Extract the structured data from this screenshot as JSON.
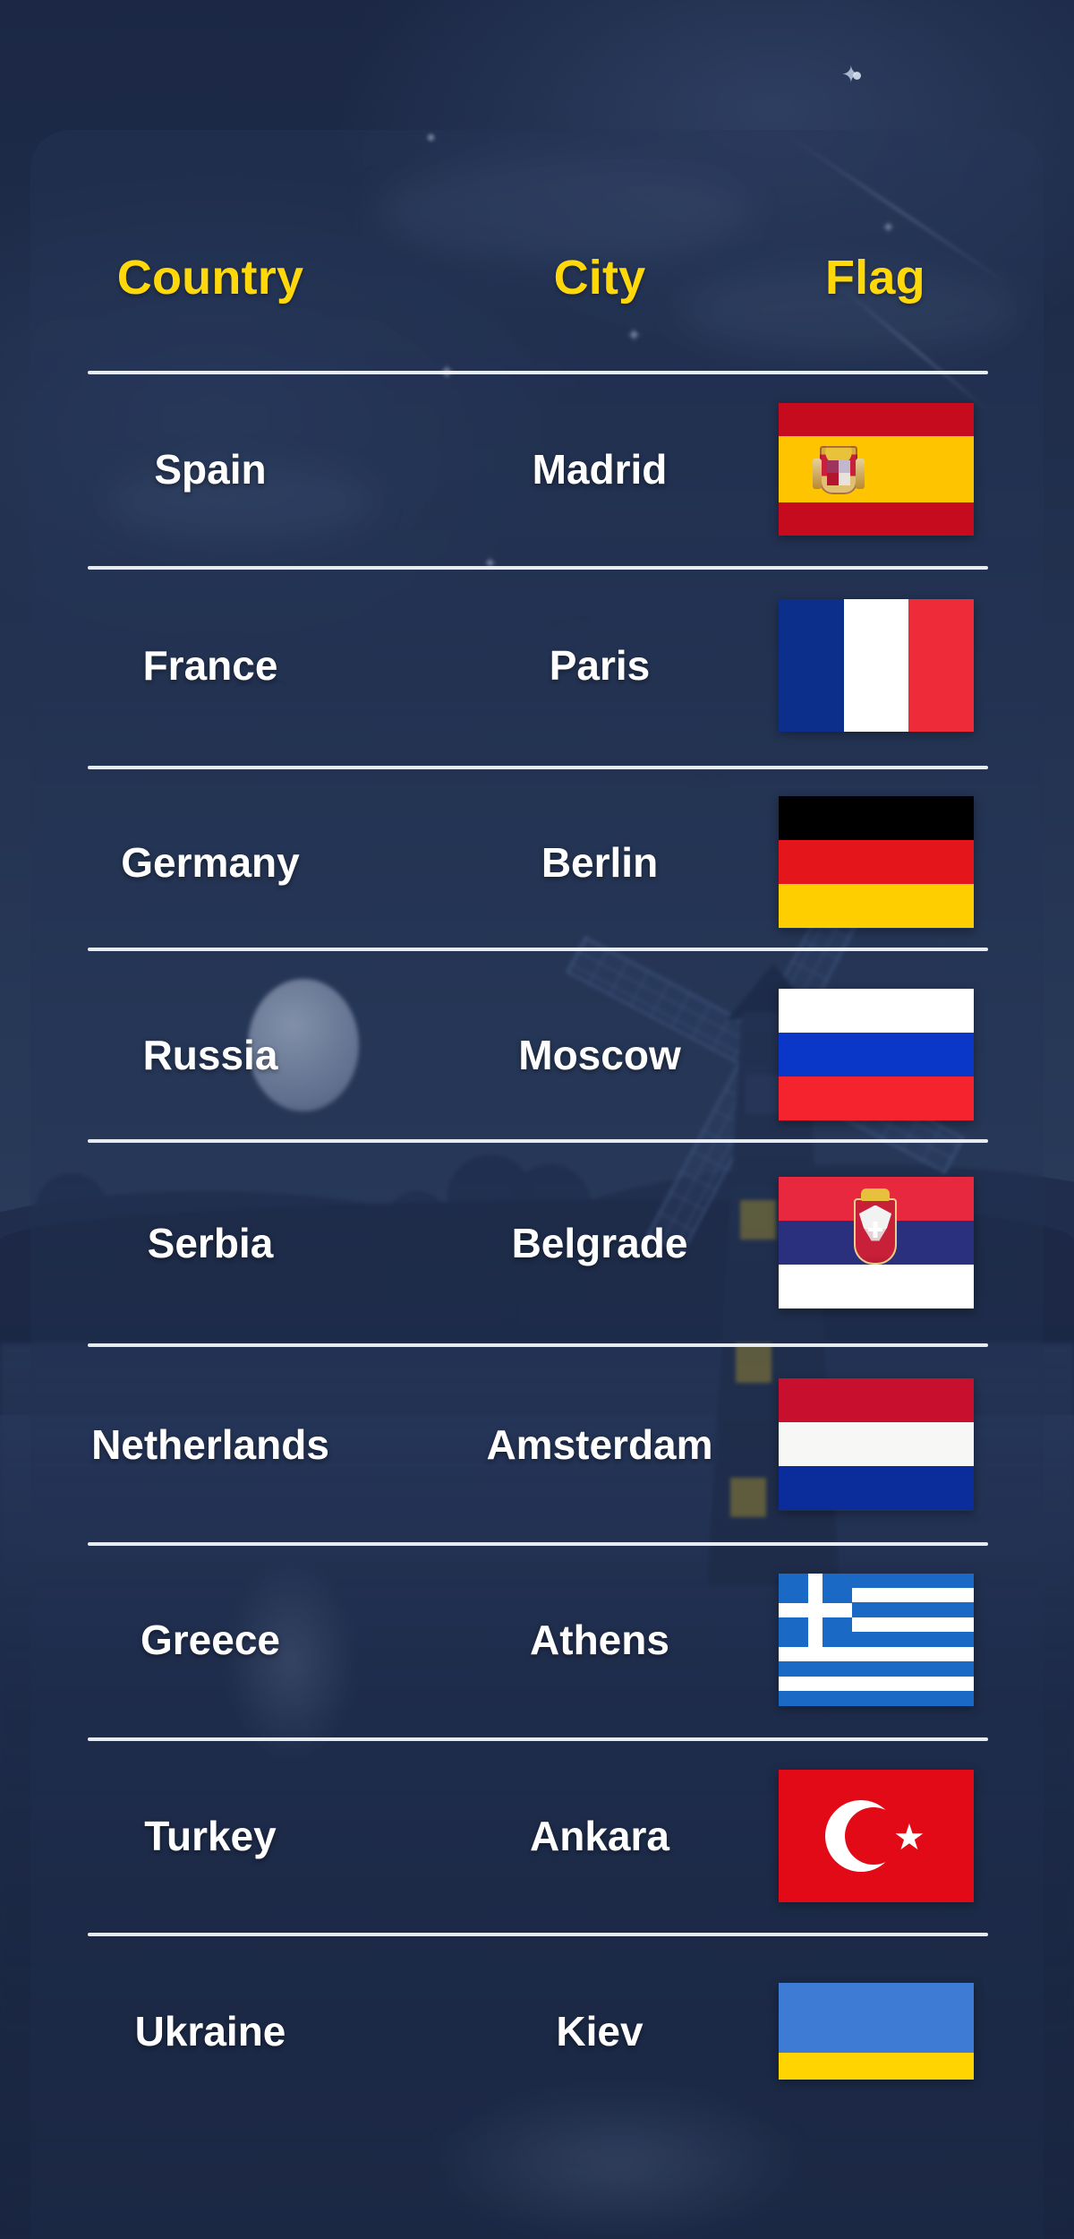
{
  "theme": {
    "background_color": "#1d2a49",
    "header_text_color": "#FFD80B",
    "body_text_color": "#FFFFFF",
    "divider_color": "#F2F6FB"
  },
  "table": {
    "headers": {
      "country": "Country",
      "city": "City",
      "flag": "Flag"
    },
    "rows": [
      {
        "country": "Spain",
        "city": "Madrid",
        "flag": "spain-flag"
      },
      {
        "country": "France",
        "city": "Paris",
        "flag": "france-flag"
      },
      {
        "country": "Germany",
        "city": "Berlin",
        "flag": "germany-flag"
      },
      {
        "country": "Russia",
        "city": "Moscow",
        "flag": "russia-flag"
      },
      {
        "country": "Serbia",
        "city": "Belgrade",
        "flag": "serbia-flag"
      },
      {
        "country": "Netherlands",
        "city": "Amsterdam",
        "flag": "netherlands-flag"
      },
      {
        "country": "Greece",
        "city": "Athens",
        "flag": "greece-flag"
      },
      {
        "country": "Turkey",
        "city": "Ankara",
        "flag": "turkey-flag"
      },
      {
        "country": "Ukraine",
        "city": "Kiev",
        "flag": "ukraine-flag"
      }
    ]
  },
  "background_scene": {
    "description": "night-sky-windmill-landscape",
    "elements": [
      "moon",
      "stars",
      "shooting-star",
      "birds",
      "windmill",
      "trees",
      "hills",
      "water-reflection"
    ]
  }
}
